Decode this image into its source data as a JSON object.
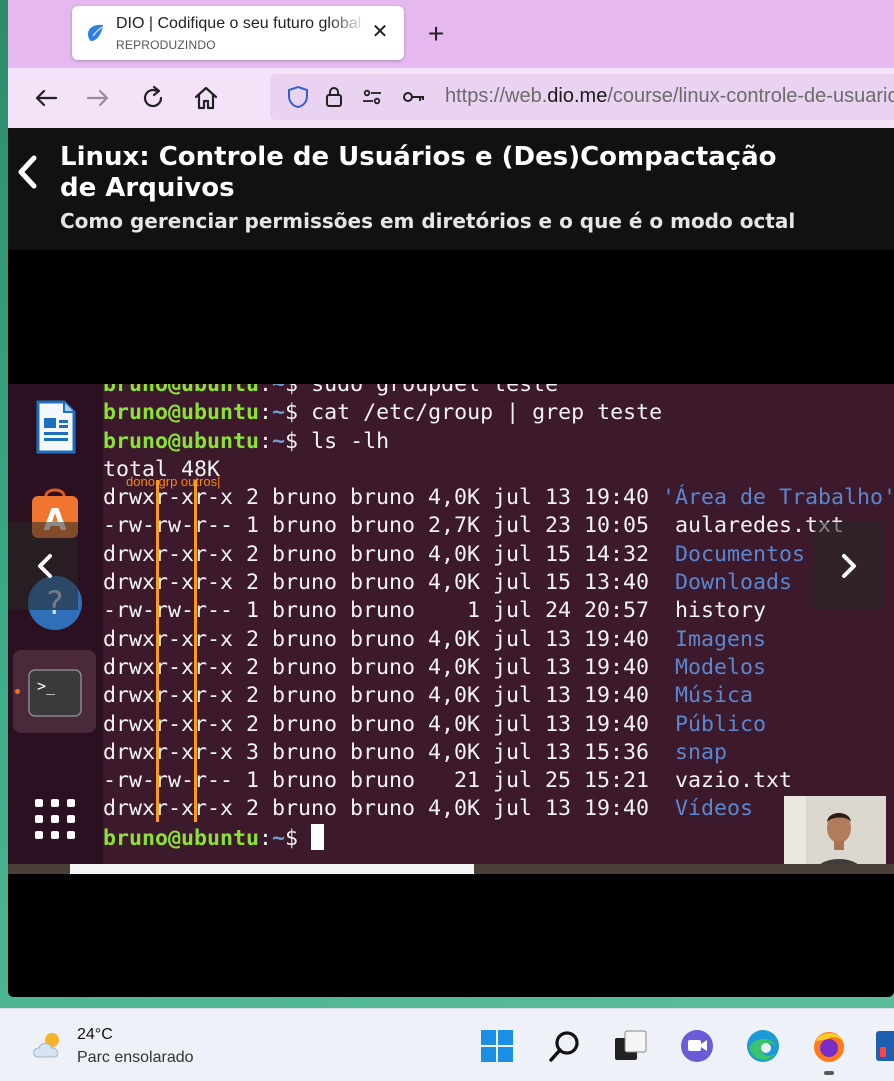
{
  "browser": {
    "tab": {
      "title": "DIO | Codifique o seu futuro global",
      "subtitle": "REPRODUZINDO"
    },
    "newtab_label": "+",
    "close_label": "✕",
    "url": {
      "prefix": "https://web.",
      "domain": "dio.me",
      "path": "/course/linux-controle-de-usuarios"
    }
  },
  "course": {
    "title": "Linux: Controle de Usuários e (Des)Compactação de Arquivos",
    "subtitle": "Como gerenciar permissões em diretórios e o que é o modo octal"
  },
  "terminal": {
    "prompt_user": "bruno@ubuntu",
    "prompt_path": "~",
    "prompt_symbol": ":",
    "prompt_end": "$ ",
    "commands": [
      "sudo groupdel teste",
      "cat /etc/group | grep teste",
      "ls -lh"
    ],
    "total": "total 48K",
    "annotation": "dono grp  outros|",
    "listing": [
      {
        "perm": "drwxr-xr-x",
        "links": "2",
        "owner": "bruno",
        "group": "bruno",
        "size": "4,0K",
        "date": "jul 13 19:40",
        "name": "'Área de Trabalho'",
        "kind": "dir"
      },
      {
        "perm": "-rw-rw-r--",
        "links": "1",
        "owner": "bruno",
        "group": "bruno",
        "size": "2,7K",
        "date": "jul 23 10:05",
        "name": " aularedes.txt",
        "kind": "file"
      },
      {
        "perm": "drwxr-xr-x",
        "links": "2",
        "owner": "bruno",
        "group": "bruno",
        "size": "4,0K",
        "date": "jul 15 14:32",
        "name": " Documentos",
        "kind": "dir"
      },
      {
        "perm": "drwxr-xr-x",
        "links": "2",
        "owner": "bruno",
        "group": "bruno",
        "size": "4,0K",
        "date": "jul 15 13:40",
        "name": " Downloads",
        "kind": "dir"
      },
      {
        "perm": "-rw-rw-r--",
        "links": "1",
        "owner": "bruno",
        "group": "bruno",
        "size": "   1",
        "date": "jul 24 20:57",
        "name": " history",
        "kind": "file"
      },
      {
        "perm": "drwxr-xr-x",
        "links": "2",
        "owner": "bruno",
        "group": "bruno",
        "size": "4,0K",
        "date": "jul 13 19:40",
        "name": " Imagens",
        "kind": "dir"
      },
      {
        "perm": "drwxr-xr-x",
        "links": "2",
        "owner": "bruno",
        "group": "bruno",
        "size": "4,0K",
        "date": "jul 13 19:40",
        "name": " Modelos",
        "kind": "dir"
      },
      {
        "perm": "drwxr-xr-x",
        "links": "2",
        "owner": "bruno",
        "group": "bruno",
        "size": "4,0K",
        "date": "jul 13 19:40",
        "name": " Música",
        "kind": "dir"
      },
      {
        "perm": "drwxr-xr-x",
        "links": "2",
        "owner": "bruno",
        "group": "bruno",
        "size": "4,0K",
        "date": "jul 13 19:40",
        "name": " Público",
        "kind": "dir"
      },
      {
        "perm": "drwxr-xr-x",
        "links": "3",
        "owner": "bruno",
        "group": "bruno",
        "size": "4,0K",
        "date": "jul 13 15:36",
        "name": " snap",
        "kind": "dir"
      },
      {
        "perm": "-rw-rw-r--",
        "links": "1",
        "owner": "bruno",
        "group": "bruno",
        "size": "  21",
        "date": "jul 25 15:21",
        "name": " vazio.txt",
        "kind": "file"
      },
      {
        "perm": "drwxr-xr-x",
        "links": "2",
        "owner": "bruno",
        "group": "bruno",
        "size": "4,0K",
        "date": "jul 13 19:40",
        "name": " Vídeos",
        "kind": "dir"
      }
    ]
  },
  "video": {
    "progress": 0.5
  },
  "taskbar": {
    "weather_temp": "24°C",
    "weather_desc": "Parc ensolarado"
  },
  "colors": {
    "tabstrip": "#e6b8f0",
    "terminal_bg": "#3c1a2c",
    "prompt_green": "#8ae234",
    "dir_blue": "#5b87d0",
    "annotation_orange": "#ff9a1a"
  }
}
